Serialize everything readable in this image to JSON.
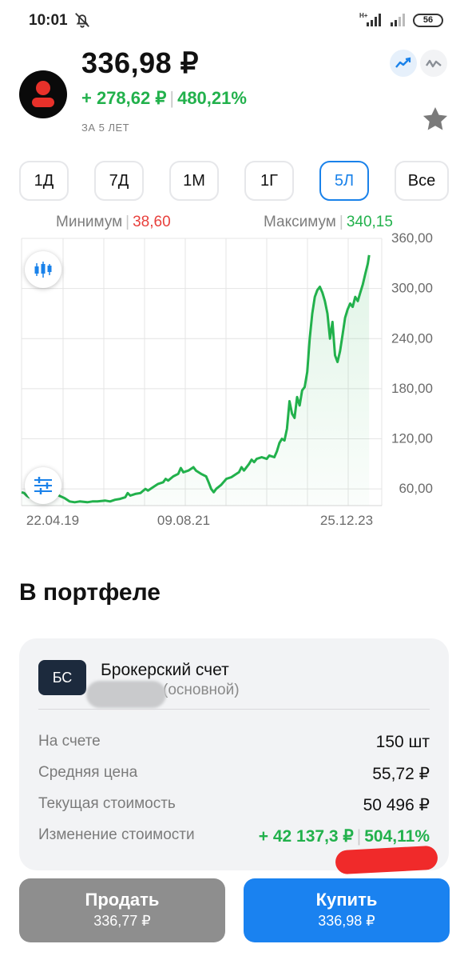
{
  "status_bar": {
    "time": "10:01",
    "network": "H+",
    "battery": "56"
  },
  "header": {
    "price": "336,98 ₽",
    "change_abs": "+ 278,62 ₽",
    "change_pct": "480,21%",
    "period": "ЗА 5 ЛЕТ"
  },
  "tabs": [
    {
      "label": "1Д",
      "active": false
    },
    {
      "label": "7Д",
      "active": false
    },
    {
      "label": "1М",
      "active": false
    },
    {
      "label": "1Г",
      "active": false
    },
    {
      "label": "5Л",
      "active": true
    },
    {
      "label": "Все",
      "active": false
    }
  ],
  "range": {
    "min_label": "Минимум",
    "min_value": "38,60",
    "max_label": "Максимум",
    "max_value": "340,15"
  },
  "colors": {
    "up": "#22b14c",
    "down": "#e8403c",
    "accent": "#1a82ea",
    "sell": "#8e8e8e",
    "buy": "#1a82f0"
  },
  "chart_data": {
    "type": "line",
    "title": "",
    "xlabel": "",
    "ylabel": "",
    "ylim": [
      40,
      360
    ],
    "y_ticks": [
      "60,00",
      "120,00",
      "180,00",
      "240,00",
      "300,00",
      "360,00"
    ],
    "x_tick_labels": [
      "22.04.19",
      "09.08.21",
      "25.12.23"
    ],
    "grid": true,
    "series": [
      {
        "values": [
          [
            0,
            56
          ],
          [
            2,
            55
          ],
          [
            4,
            52
          ],
          [
            6,
            50
          ],
          [
            8,
            54
          ],
          [
            10,
            52
          ],
          [
            14,
            51
          ],
          [
            18,
            48
          ],
          [
            22,
            53
          ],
          [
            26,
            55
          ],
          [
            28,
            53
          ],
          [
            34,
            49
          ],
          [
            38,
            45
          ],
          [
            42,
            44
          ],
          [
            46,
            45
          ],
          [
            52,
            44
          ],
          [
            56,
            45
          ],
          [
            60,
            45
          ],
          [
            66,
            46
          ],
          [
            70,
            45
          ],
          [
            74,
            47
          ],
          [
            78,
            48
          ],
          [
            82,
            50
          ],
          [
            84,
            55
          ],
          [
            86,
            52
          ],
          [
            90,
            54
          ],
          [
            94,
            55
          ],
          [
            98,
            60
          ],
          [
            100,
            58
          ],
          [
            104,
            62
          ],
          [
            108,
            66
          ],
          [
            112,
            68
          ],
          [
            114,
            72
          ],
          [
            116,
            70
          ],
          [
            120,
            75
          ],
          [
            124,
            78
          ],
          [
            126,
            85
          ],
          [
            128,
            80
          ],
          [
            132,
            82
          ],
          [
            136,
            86
          ],
          [
            138,
            82
          ],
          [
            142,
            78
          ],
          [
            146,
            75
          ],
          [
            148,
            68
          ],
          [
            150,
            60
          ],
          [
            152,
            56
          ],
          [
            154,
            60
          ],
          [
            158,
            65
          ],
          [
            162,
            72
          ],
          [
            166,
            74
          ],
          [
            168,
            76
          ],
          [
            172,
            80
          ],
          [
            174,
            86
          ],
          [
            176,
            82
          ],
          [
            180,
            90
          ],
          [
            182,
            95
          ],
          [
            184,
            92
          ],
          [
            186,
            96
          ],
          [
            190,
            98
          ],
          [
            194,
            96
          ],
          [
            196,
            100
          ],
          [
            200,
            98
          ],
          [
            202,
            105
          ],
          [
            204,
            115
          ],
          [
            206,
            120
          ],
          [
            208,
            118
          ],
          [
            210,
            132
          ],
          [
            212,
            165
          ],
          [
            214,
            150
          ],
          [
            216,
            145
          ],
          [
            218,
            170
          ],
          [
            220,
            160
          ],
          [
            222,
            178
          ],
          [
            224,
            182
          ],
          [
            226,
            200
          ],
          [
            228,
            240
          ],
          [
            230,
            270
          ],
          [
            232,
            290
          ],
          [
            234,
            298
          ],
          [
            236,
            302
          ],
          [
            238,
            295
          ],
          [
            240,
            285
          ],
          [
            242,
            270
          ],
          [
            244,
            240
          ],
          [
            246,
            260
          ],
          [
            248,
            220
          ],
          [
            250,
            212
          ],
          [
            252,
            225
          ],
          [
            254,
            245
          ],
          [
            256,
            265
          ],
          [
            258,
            275
          ],
          [
            260,
            282
          ],
          [
            262,
            278
          ],
          [
            264,
            290
          ],
          [
            266,
            285
          ],
          [
            268,
            295
          ],
          [
            270,
            305
          ],
          [
            272,
            318
          ],
          [
            274,
            330
          ],
          [
            275,
            340
          ]
        ]
      }
    ]
  },
  "portfolio": {
    "title": "В портфеле",
    "account_badge": "БС",
    "account_name": "Брокерский счет",
    "account_sub": "(основной)",
    "rows": [
      {
        "label": "На счете",
        "value": "150 шт"
      },
      {
        "label": "Средняя цена",
        "value": "55,72 ₽"
      },
      {
        "label": "Текущая стоимость",
        "value": "50 496 ₽"
      }
    ],
    "change_label": "Изменение стоимости",
    "change_abs": "+ 42 137,3 ₽",
    "change_pct": "504,11%"
  },
  "actions": {
    "sell_label": "Продать",
    "sell_price": "336,77 ₽",
    "buy_label": "Купить",
    "buy_price": "336,98 ₽"
  },
  "icons": {
    "mute": "bell-off-icon",
    "signal": "signal-icon",
    "battery": "battery-icon",
    "logo": "company-logo",
    "chart_mode_line": "trend-line-icon",
    "chart_mode_alt": "wave-line-icon",
    "favorite": "star-icon",
    "candles": "candlestick-icon",
    "settings": "sliders-icon"
  }
}
